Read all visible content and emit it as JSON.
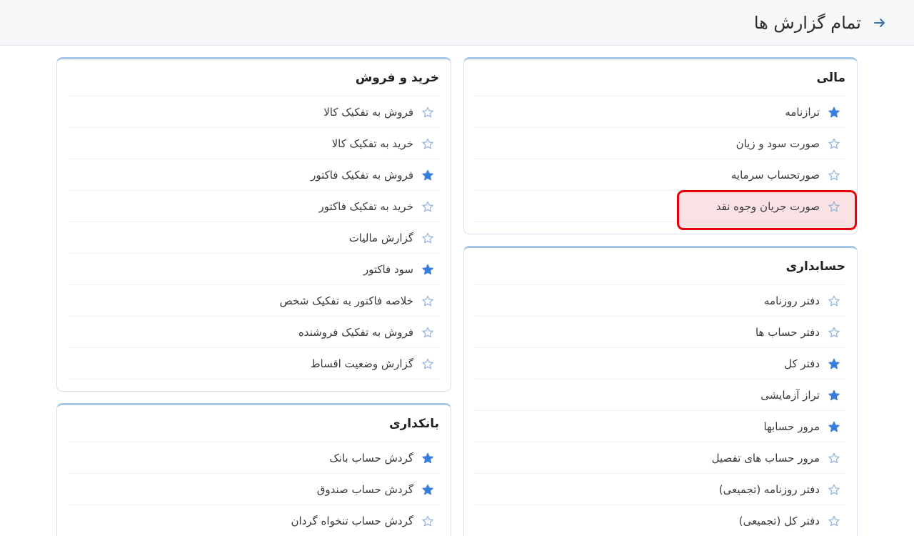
{
  "header": {
    "title": "تمام گزارش ها",
    "back_icon": "arrow-right-icon"
  },
  "colors": {
    "star_filled": "#3b7ddd",
    "star_outline": "#8fb2de",
    "highlight": "#e8000c",
    "card_top": "#a8c8ea"
  },
  "cards": {
    "mali": {
      "title": "مالی",
      "items": [
        {
          "label": "ترازنامه",
          "starred": true
        },
        {
          "label": "صورت سود و زیان",
          "starred": false
        },
        {
          "label": "صورتحساب سرمایه",
          "starred": false
        },
        {
          "label": "صورت جریان وجوه نقد",
          "starred": false
        }
      ]
    },
    "hesabdari": {
      "title": "حسابداری",
      "items": [
        {
          "label": "دفتر روزنامه",
          "starred": false
        },
        {
          "label": "دفتر حساب ها",
          "starred": false
        },
        {
          "label": "دفتر کل",
          "starred": true
        },
        {
          "label": "تراز آزمایشی",
          "starred": true
        },
        {
          "label": "مرور حسابها",
          "starred": true
        },
        {
          "label": "مرور حساب های تفصیل",
          "starred": false
        },
        {
          "label": "دفتر روزنامه (تجمیعی)",
          "starred": false
        },
        {
          "label": "دفتر کل (تجمیعی)",
          "starred": false
        }
      ]
    },
    "kharid": {
      "title": "خرید و فروش",
      "items": [
        {
          "label": "فروش به تفکیک کالا",
          "starred": false
        },
        {
          "label": "خرید به تفکیک کالا",
          "starred": false
        },
        {
          "label": "فروش به تفکیک فاکتور",
          "starred": true
        },
        {
          "label": "خرید به تفکیک فاکتور",
          "starred": false
        },
        {
          "label": "گزارش مالیات",
          "starred": false
        },
        {
          "label": "سود فاکتور",
          "starred": true
        },
        {
          "label": "خلاصه فاکتور به تفکیک شخص",
          "starred": false
        },
        {
          "label": "فروش به تفکیک فروشنده",
          "starred": false
        },
        {
          "label": "گزارش وضعیت اقساط",
          "starred": false
        }
      ]
    },
    "bank": {
      "title": "بانکداری",
      "items": [
        {
          "label": "گردش حساب بانک",
          "starred": true
        },
        {
          "label": "گردش حساب صندوق",
          "starred": true
        },
        {
          "label": "گردش حساب تنخواه گردان",
          "starred": false
        }
      ]
    }
  }
}
